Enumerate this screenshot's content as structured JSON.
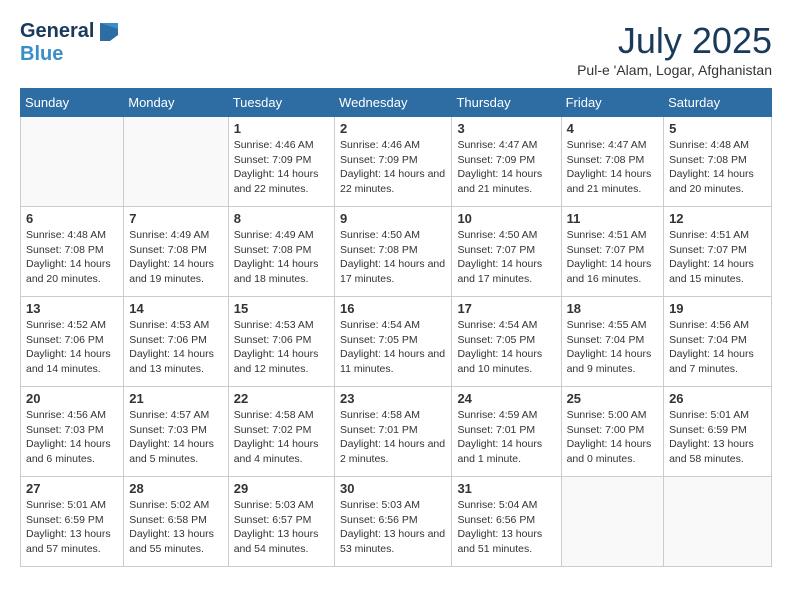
{
  "header": {
    "logo_general": "General",
    "logo_blue": "Blue",
    "title": "July 2025",
    "subtitle": "Pul-e 'Alam, Logar, Afghanistan"
  },
  "days_of_week": [
    "Sunday",
    "Monday",
    "Tuesday",
    "Wednesday",
    "Thursday",
    "Friday",
    "Saturday"
  ],
  "weeks": [
    [
      {
        "day": "",
        "sunrise": "",
        "sunset": "",
        "daylight": ""
      },
      {
        "day": "",
        "sunrise": "",
        "sunset": "",
        "daylight": ""
      },
      {
        "day": "1",
        "sunrise": "Sunrise: 4:46 AM",
        "sunset": "Sunset: 7:09 PM",
        "daylight": "Daylight: 14 hours and 22 minutes."
      },
      {
        "day": "2",
        "sunrise": "Sunrise: 4:46 AM",
        "sunset": "Sunset: 7:09 PM",
        "daylight": "Daylight: 14 hours and 22 minutes."
      },
      {
        "day": "3",
        "sunrise": "Sunrise: 4:47 AM",
        "sunset": "Sunset: 7:09 PM",
        "daylight": "Daylight: 14 hours and 21 minutes."
      },
      {
        "day": "4",
        "sunrise": "Sunrise: 4:47 AM",
        "sunset": "Sunset: 7:08 PM",
        "daylight": "Daylight: 14 hours and 21 minutes."
      },
      {
        "day": "5",
        "sunrise": "Sunrise: 4:48 AM",
        "sunset": "Sunset: 7:08 PM",
        "daylight": "Daylight: 14 hours and 20 minutes."
      }
    ],
    [
      {
        "day": "6",
        "sunrise": "Sunrise: 4:48 AM",
        "sunset": "Sunset: 7:08 PM",
        "daylight": "Daylight: 14 hours and 20 minutes."
      },
      {
        "day": "7",
        "sunrise": "Sunrise: 4:49 AM",
        "sunset": "Sunset: 7:08 PM",
        "daylight": "Daylight: 14 hours and 19 minutes."
      },
      {
        "day": "8",
        "sunrise": "Sunrise: 4:49 AM",
        "sunset": "Sunset: 7:08 PM",
        "daylight": "Daylight: 14 hours and 18 minutes."
      },
      {
        "day": "9",
        "sunrise": "Sunrise: 4:50 AM",
        "sunset": "Sunset: 7:08 PM",
        "daylight": "Daylight: 14 hours and 17 minutes."
      },
      {
        "day": "10",
        "sunrise": "Sunrise: 4:50 AM",
        "sunset": "Sunset: 7:07 PM",
        "daylight": "Daylight: 14 hours and 17 minutes."
      },
      {
        "day": "11",
        "sunrise": "Sunrise: 4:51 AM",
        "sunset": "Sunset: 7:07 PM",
        "daylight": "Daylight: 14 hours and 16 minutes."
      },
      {
        "day": "12",
        "sunrise": "Sunrise: 4:51 AM",
        "sunset": "Sunset: 7:07 PM",
        "daylight": "Daylight: 14 hours and 15 minutes."
      }
    ],
    [
      {
        "day": "13",
        "sunrise": "Sunrise: 4:52 AM",
        "sunset": "Sunset: 7:06 PM",
        "daylight": "Daylight: 14 hours and 14 minutes."
      },
      {
        "day": "14",
        "sunrise": "Sunrise: 4:53 AM",
        "sunset": "Sunset: 7:06 PM",
        "daylight": "Daylight: 14 hours and 13 minutes."
      },
      {
        "day": "15",
        "sunrise": "Sunrise: 4:53 AM",
        "sunset": "Sunset: 7:06 PM",
        "daylight": "Daylight: 14 hours and 12 minutes."
      },
      {
        "day": "16",
        "sunrise": "Sunrise: 4:54 AM",
        "sunset": "Sunset: 7:05 PM",
        "daylight": "Daylight: 14 hours and 11 minutes."
      },
      {
        "day": "17",
        "sunrise": "Sunrise: 4:54 AM",
        "sunset": "Sunset: 7:05 PM",
        "daylight": "Daylight: 14 hours and 10 minutes."
      },
      {
        "day": "18",
        "sunrise": "Sunrise: 4:55 AM",
        "sunset": "Sunset: 7:04 PM",
        "daylight": "Daylight: 14 hours and 9 minutes."
      },
      {
        "day": "19",
        "sunrise": "Sunrise: 4:56 AM",
        "sunset": "Sunset: 7:04 PM",
        "daylight": "Daylight: 14 hours and 7 minutes."
      }
    ],
    [
      {
        "day": "20",
        "sunrise": "Sunrise: 4:56 AM",
        "sunset": "Sunset: 7:03 PM",
        "daylight": "Daylight: 14 hours and 6 minutes."
      },
      {
        "day": "21",
        "sunrise": "Sunrise: 4:57 AM",
        "sunset": "Sunset: 7:03 PM",
        "daylight": "Daylight: 14 hours and 5 minutes."
      },
      {
        "day": "22",
        "sunrise": "Sunrise: 4:58 AM",
        "sunset": "Sunset: 7:02 PM",
        "daylight": "Daylight: 14 hours and 4 minutes."
      },
      {
        "day": "23",
        "sunrise": "Sunrise: 4:58 AM",
        "sunset": "Sunset: 7:01 PM",
        "daylight": "Daylight: 14 hours and 2 minutes."
      },
      {
        "day": "24",
        "sunrise": "Sunrise: 4:59 AM",
        "sunset": "Sunset: 7:01 PM",
        "daylight": "Daylight: 14 hours and 1 minute."
      },
      {
        "day": "25",
        "sunrise": "Sunrise: 5:00 AM",
        "sunset": "Sunset: 7:00 PM",
        "daylight": "Daylight: 14 hours and 0 minutes."
      },
      {
        "day": "26",
        "sunrise": "Sunrise: 5:01 AM",
        "sunset": "Sunset: 6:59 PM",
        "daylight": "Daylight: 13 hours and 58 minutes."
      }
    ],
    [
      {
        "day": "27",
        "sunrise": "Sunrise: 5:01 AM",
        "sunset": "Sunset: 6:59 PM",
        "daylight": "Daylight: 13 hours and 57 minutes."
      },
      {
        "day": "28",
        "sunrise": "Sunrise: 5:02 AM",
        "sunset": "Sunset: 6:58 PM",
        "daylight": "Daylight: 13 hours and 55 minutes."
      },
      {
        "day": "29",
        "sunrise": "Sunrise: 5:03 AM",
        "sunset": "Sunset: 6:57 PM",
        "daylight": "Daylight: 13 hours and 54 minutes."
      },
      {
        "day": "30",
        "sunrise": "Sunrise: 5:03 AM",
        "sunset": "Sunset: 6:56 PM",
        "daylight": "Daylight: 13 hours and 53 minutes."
      },
      {
        "day": "31",
        "sunrise": "Sunrise: 5:04 AM",
        "sunset": "Sunset: 6:56 PM",
        "daylight": "Daylight: 13 hours and 51 minutes."
      },
      {
        "day": "",
        "sunrise": "",
        "sunset": "",
        "daylight": ""
      },
      {
        "day": "",
        "sunrise": "",
        "sunset": "",
        "daylight": ""
      }
    ]
  ]
}
